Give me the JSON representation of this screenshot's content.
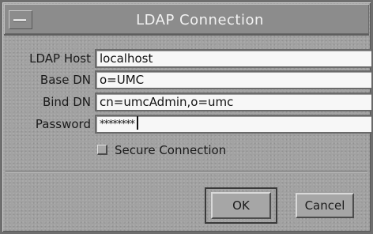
{
  "window": {
    "title": "LDAP Connection"
  },
  "form": {
    "ldap_host": {
      "label": "LDAP Host",
      "value": "localhost"
    },
    "base_dn": {
      "label": "Base DN",
      "value": "o=UMC"
    },
    "bind_dn": {
      "label": "Bind DN",
      "value": "cn=umcAdmin,o=umc"
    },
    "password": {
      "label": "Password",
      "value": "********"
    },
    "secure_connection": {
      "label": "Secure Connection",
      "checked": false
    }
  },
  "buttons": {
    "ok_label": "OK",
    "cancel_label": "Cancel"
  },
  "icons": {
    "window_menu": "window-menu-icon"
  }
}
